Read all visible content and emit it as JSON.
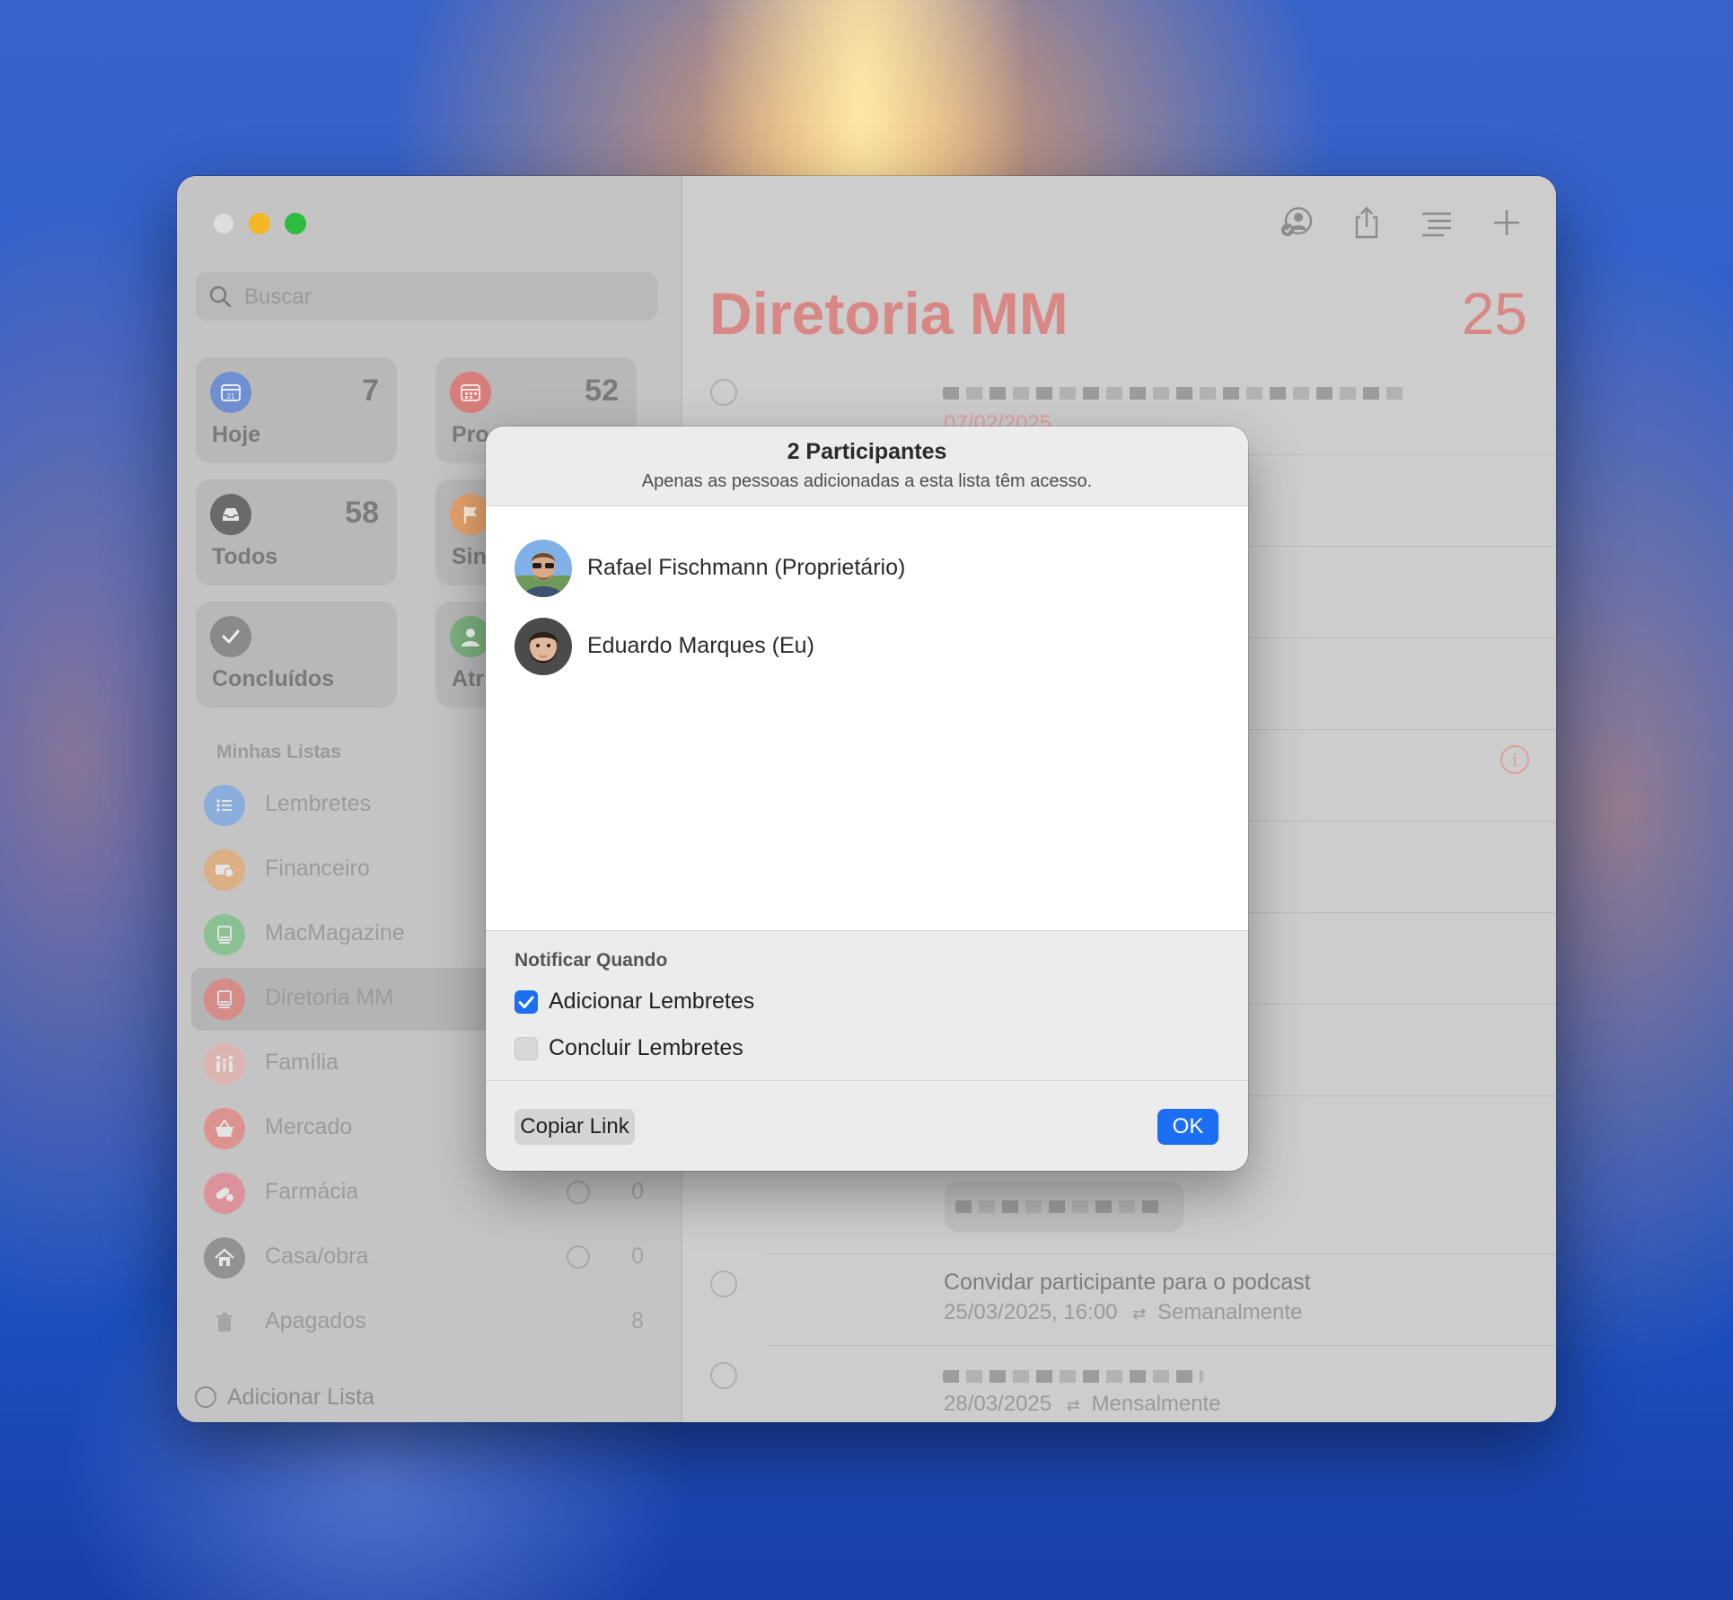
{
  "sidebar": {
    "search_placeholder": "Buscar",
    "smart_lists": [
      {
        "label": "Hoje",
        "count": "7",
        "color": "#6f8fd0"
      },
      {
        "label": "Pro",
        "count": "52",
        "color": "#d77d7a"
      },
      {
        "label": "Todos",
        "count": "58",
        "color": "#6a6a6a"
      },
      {
        "label": "Sin",
        "count": "",
        "color": "#e6a36c"
      },
      {
        "label": "Concluídos",
        "count": "",
        "color": "#8a8a8a"
      },
      {
        "label": "Atr",
        "count": "",
        "color": "#7cb07e"
      }
    ],
    "section_title": "Minhas Listas",
    "lists": [
      {
        "label": "Lembretes",
        "count": "",
        "color": "#5c9cf0"
      },
      {
        "label": "Financeiro",
        "count": "",
        "color": "#f0a052"
      },
      {
        "label": "MacMagazine",
        "count": "",
        "color": "#5ac06a"
      },
      {
        "label": "Diretoria MM",
        "count": "",
        "color": "#f06a62"
      },
      {
        "label": "Família",
        "count": "",
        "color": "#f0a8a0"
      },
      {
        "label": "Mercado",
        "count": "",
        "color": "#f06a62"
      },
      {
        "label": "Farmácia",
        "count": "0",
        "color": "#f06a7a"
      },
      {
        "label": "Casa/obra",
        "count": "0",
        "color": "#6a6a6a"
      },
      {
        "label": "Apagados",
        "count": "8",
        "color": "#b0b0b0"
      }
    ],
    "add_list_label": "Adicionar Lista"
  },
  "main": {
    "title": "Diretoria MM",
    "count": "25",
    "first_task_date": "07/02/2025",
    "tasks": [
      {
        "title": "Convidar participante para o podcast",
        "date": "25/03/2025, 16:00",
        "repeat": "Semanalmente"
      },
      {
        "title": "",
        "date": "28/03/2025",
        "repeat": "Mensalmente"
      }
    ],
    "repeat_glyph": "⇄",
    "accent_color": "#d98784"
  },
  "dialog": {
    "title": "2 Participantes",
    "subtitle": "Apenas as pessoas adicionadas a esta lista têm acesso.",
    "participants": [
      {
        "name": "Rafael Fischmann (Proprietário)"
      },
      {
        "name": "Eduardo Marques (Eu)"
      }
    ],
    "notify_title": "Notificar Quando",
    "options": [
      {
        "label": "Adicionar Lembretes",
        "checked": true
      },
      {
        "label": "Concluir Lembretes",
        "checked": false
      }
    ],
    "copy_link_label": "Copiar Link",
    "ok_label": "OK",
    "accent_color": "#1c6ef2"
  }
}
